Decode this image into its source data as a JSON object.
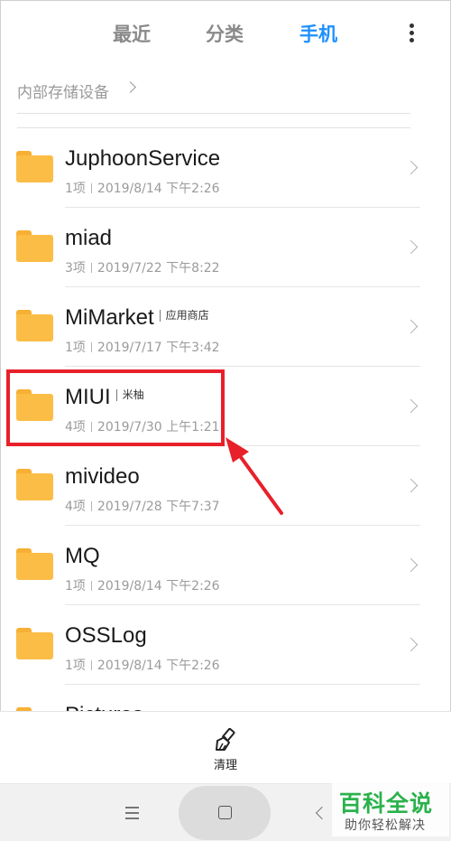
{
  "tabs": [
    {
      "label": "最近"
    },
    {
      "label": "分类"
    },
    {
      "label": "手机"
    }
  ],
  "breadcrumb": {
    "label": "内部存储设备"
  },
  "folders": [
    {
      "name": "JuphoonService",
      "tag": "",
      "count": "1项",
      "date": "2019/8/14 下午2:26"
    },
    {
      "name": "miad",
      "tag": "",
      "count": "3项",
      "date": "2019/7/22 下午8:22"
    },
    {
      "name": "MiMarket",
      "tag": "应用商店",
      "count": "1项",
      "date": "2019/7/17 下午3:42"
    },
    {
      "name": "MIUI",
      "tag": "米柚",
      "count": "4项",
      "date": "2019/7/30 上午1:21"
    },
    {
      "name": "mivideo",
      "tag": "",
      "count": "4项",
      "date": "2019/7/28 下午7:37"
    },
    {
      "name": "MQ",
      "tag": "",
      "count": "1项",
      "date": "2019/8/14 下午2:26"
    },
    {
      "name": "OSSLog",
      "tag": "",
      "count": "1项",
      "date": "2019/8/14 下午2:26"
    },
    {
      "name": "Pictures",
      "tag": "",
      "count": "",
      "date": ""
    }
  ],
  "toolbar": {
    "clean_label": "清理"
  },
  "watermark": {
    "title": "百科全说",
    "subtitle": "助你轻松解决"
  },
  "colors": {
    "accent": "#1e90ff",
    "folder": "#fbbd46",
    "highlight": "#e8202a",
    "watermark": "#2bb24c"
  }
}
